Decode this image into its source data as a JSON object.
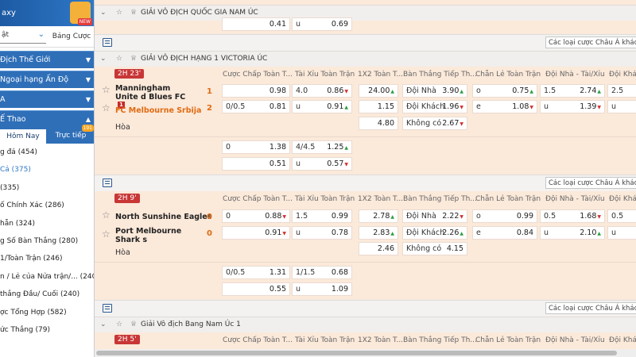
{
  "sidebar": {
    "top_label": "axy",
    "tab_select": "ật",
    "tab_other": "Bảng Cược",
    "sections": [
      {
        "label": "Địch Thế Giới"
      },
      {
        "label": "Ngoại hạng Ấn Độ"
      },
      {
        "label": "A"
      },
      {
        "label": "Ế Thao"
      }
    ],
    "sub_tabs": {
      "today": "Hôm Nay",
      "live": "Trực tiếp",
      "live_count": "191"
    },
    "items": [
      {
        "label": "g đá (454)"
      },
      {
        "label": "Cả (375)"
      },
      {
        "label": "(335)"
      },
      {
        "label": "ố Chính Xác (286)"
      },
      {
        "label": "hẵn (324)"
      },
      {
        "label": "g Số Bàn Thắng (280)"
      },
      {
        "label": "1/Toàn Trận (246)"
      },
      {
        "label": "n / Lẻ của Nửa trận/... (240)"
      },
      {
        "label": "thắng Đầu/ Cuối (240)"
      },
      {
        "label": "ợc Tổng Hợp (582)"
      },
      {
        "label": "ức Thắng (79)"
      }
    ]
  },
  "leagues": [
    {
      "name": "GIẢI VÔ ĐỊCH QUỐC GIA NAM ÚC"
    },
    {
      "name": "GIẢI VÔ ĐỊCH HẠNG 1 VICTORIA ÚC"
    },
    {
      "name": "Giải Vô địch Bang Nam Úc 1"
    }
  ],
  "top_row": {
    "c1": "0.41",
    "c2l": "u",
    "c2": "0.69"
  },
  "market_select": "Các loại cược Châu Á khác",
  "columns": [
    "Cược Chấp Toàn T...",
    "Tài Xỉu Toàn Trận",
    "1X2 Toàn T...",
    "Bàn Thắng Tiếp Th...",
    "Chẵn Lẻ Toàn Trận",
    "Đội Nhà - Tài/Xỉu",
    "Đội Khá"
  ],
  "match1": {
    "time": "2H 23'",
    "home": "Manningham Unite d Blues FC",
    "home_red": "1",
    "away": "FC Melbourne Srbija",
    "home_score": "1",
    "away_score": "2",
    "draw": "Hòa",
    "r1": {
      "hdp_l": "",
      "hdp": "0.98",
      "ou_l": "4.0",
      "ou": "0.86",
      "x1": "24.00",
      "ng_l": "Đội Nhà",
      "ng": "3.90",
      "oe_l": "o",
      "oe": "0.75",
      "ht_l": "1.5",
      "ht": "2.74",
      "at_l": "2.5"
    },
    "r2": {
      "hdp_l": "0/0.5",
      "hdp": "0.81",
      "ou_l": "u",
      "ou": "0.91",
      "x1": "1.15",
      "ng_l": "Đội Khách",
      "ng": "1.96",
      "oe_l": "e",
      "oe": "1.08",
      "ht_l": "u",
      "ht": "1.39",
      "at_l": "u"
    },
    "r3": {
      "x1": "4.80",
      "ng_l": "Không có",
      "ng": "2.67"
    },
    "r4": {
      "hdp_l": "0",
      "hdp": "1.38",
      "ou_l": "4/4.5",
      "ou": "1.25"
    },
    "r5": {
      "hdp": "0.51",
      "ou_l": "u",
      "ou": "0.57"
    }
  },
  "match2": {
    "time": "2H 9'",
    "home": "North Sunshine Eagles",
    "away": "Port Melbourne Shark s",
    "home_score": "0",
    "away_score": "0",
    "draw": "Hòa",
    "r1": {
      "hdp_l": "0",
      "hdp": "0.88",
      "ou_l": "1.5",
      "ou": "0.99",
      "x1": "2.78",
      "ng_l": "Đội Nhà",
      "ng": "2.22",
      "oe_l": "o",
      "oe": "0.99",
      "ht_l": "0.5",
      "ht": "1.68",
      "at_l": "0.5"
    },
    "r2": {
      "hdp": "0.91",
      "ou_l": "u",
      "ou": "0.78",
      "x1": "2.83",
      "ng_l": "Đội Khách",
      "ng": "2.26",
      "oe_l": "e",
      "oe": "0.84",
      "ht_l": "u",
      "ht": "2.10",
      "at_l": "u"
    },
    "r3": {
      "x1": "2.46",
      "ng_l": "Không có",
      "ng": "4.15"
    },
    "r4": {
      "hdp_l": "0/0.5",
      "hdp": "1.31",
      "ou_l": "1/1.5",
      "ou": "0.68"
    },
    "r5": {
      "hdp": "0.55",
      "ou_l": "u",
      "ou": "1.09"
    }
  },
  "match3": {
    "time": "2H 5'"
  }
}
